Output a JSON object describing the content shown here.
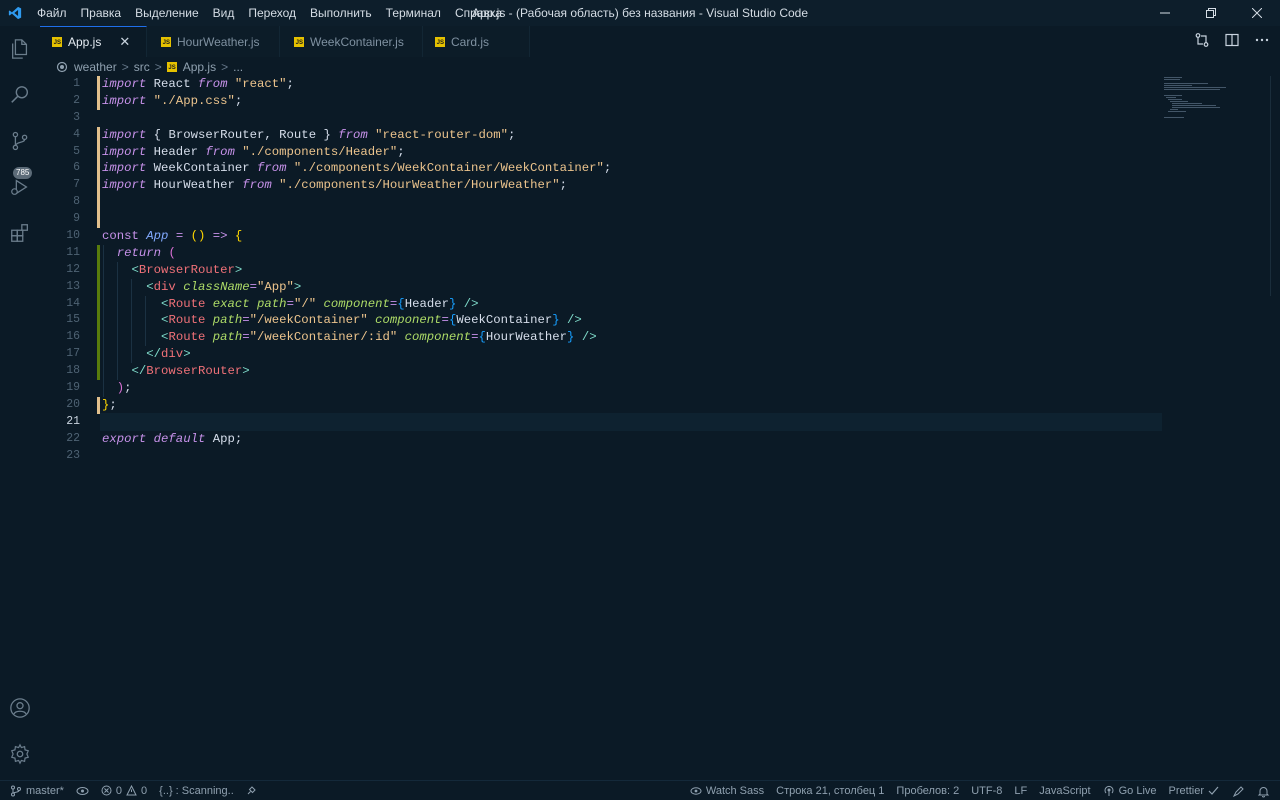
{
  "window": {
    "title": "App.js - (Рабочая область) без названия - Visual Studio Code"
  },
  "menu": [
    "Файл",
    "Правка",
    "Выделение",
    "Вид",
    "Переход",
    "Выполнить",
    "Терминал",
    "Справка"
  ],
  "activity": {
    "scm_badge": "785"
  },
  "tabs": [
    {
      "label": "App.js",
      "active": true
    },
    {
      "label": "HourWeather.js",
      "active": false
    },
    {
      "label": "WeekContainer.js",
      "active": false
    },
    {
      "label": "Card.js",
      "active": false
    }
  ],
  "breadcrumb": [
    "weather",
    "src",
    "App.js",
    "..."
  ],
  "editor": {
    "line_numbers": [
      "1",
      "2",
      "3",
      "4",
      "5",
      "6",
      "7",
      "8",
      "9",
      "10",
      "11",
      "12",
      "13",
      "14",
      "15",
      "16",
      "17",
      "18",
      "19",
      "20",
      "21",
      "22",
      "23"
    ]
  },
  "statusbar": {
    "branch": "master*",
    "errors": "0",
    "warnings": "0",
    "scanning": "{..} : Scanning..",
    "watch_sass": "Watch Sass",
    "position": "Строка 21, столбец 1",
    "spaces": "Пробелов: 2",
    "encoding": "UTF-8",
    "eol": "LF",
    "language": "JavaScript",
    "go_live": "Go Live",
    "prettier": "Prettier"
  },
  "colors": {
    "background": "#0b1a26",
    "accent": "#1f6feb",
    "modified_bar": "#e2c08d",
    "added_bar": "#587c0c"
  }
}
